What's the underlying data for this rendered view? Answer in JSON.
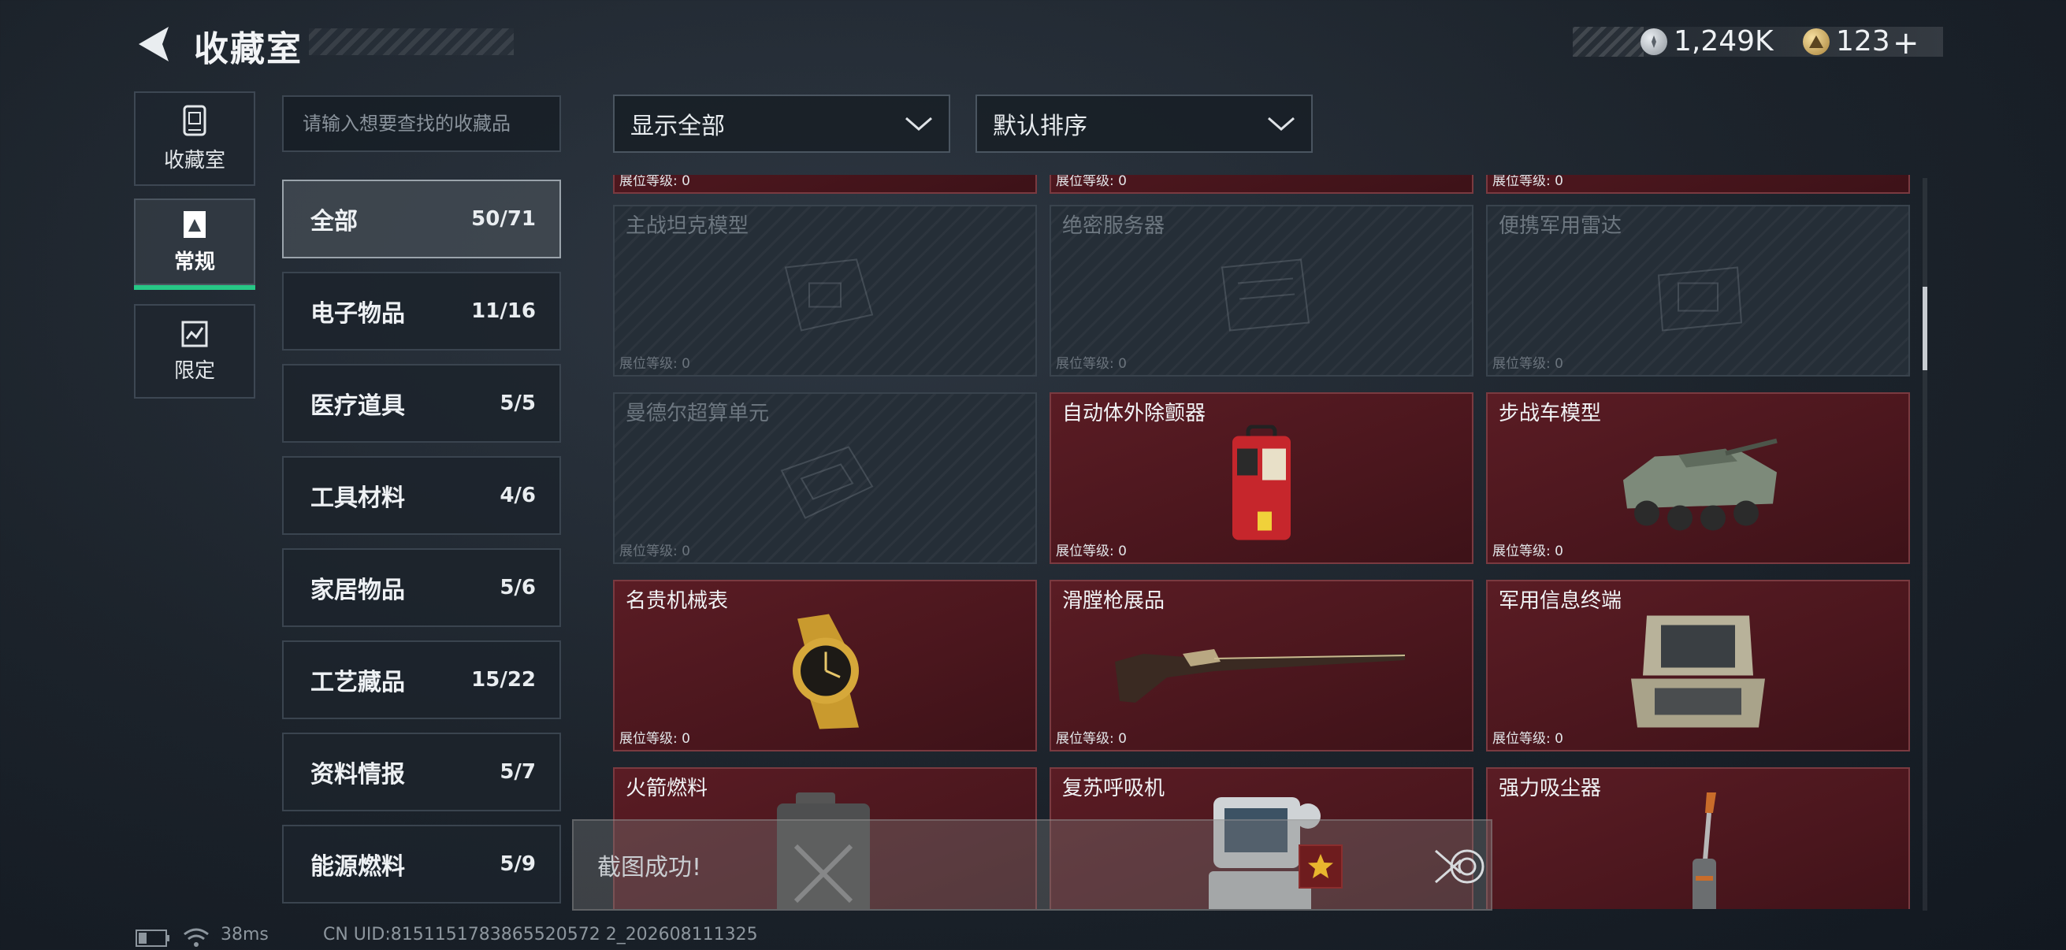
{
  "header": {
    "title": "收藏室"
  },
  "currency": {
    "silver": "1,249K",
    "gold": "123"
  },
  "rail": [
    {
      "label": "收藏室",
      "icon": "collection-icon"
    },
    {
      "label": "常规",
      "icon": "regular-icon",
      "active": true
    },
    {
      "label": "限定",
      "icon": "limited-icon"
    }
  ],
  "search": {
    "placeholder": "请输入想要查找的收藏品"
  },
  "filters": {
    "show": "显示全部",
    "sort": "默认排序"
  },
  "categories": [
    {
      "name": "全部",
      "count": "50/71",
      "active": true
    },
    {
      "name": "电子物品",
      "count": "11/16"
    },
    {
      "name": "医疗道具",
      "count": "5/5"
    },
    {
      "name": "工具材料",
      "count": "4/6"
    },
    {
      "name": "家居物品",
      "count": "5/6"
    },
    {
      "name": "工艺藏品",
      "count": "15/22"
    },
    {
      "name": "资料情报",
      "count": "5/7"
    },
    {
      "name": "能源燃料",
      "count": "5/9"
    }
  ],
  "cards": [
    {
      "name": "",
      "level": "展位等级: 0",
      "owned": true,
      "icon": ""
    },
    {
      "name": "",
      "level": "展位等级: 0",
      "owned": true,
      "icon": ""
    },
    {
      "name": "",
      "level": "展位等级: 0",
      "owned": true,
      "icon": ""
    },
    {
      "name": "主战坦克模型",
      "level": "展位等级: 0",
      "owned": false,
      "icon": "tank-model-icon"
    },
    {
      "name": "绝密服务器",
      "level": "展位等级: 0",
      "owned": false,
      "icon": "server-icon"
    },
    {
      "name": "便携军用雷达",
      "level": "展位等级: 0",
      "owned": false,
      "icon": "radar-icon"
    },
    {
      "name": "曼德尔超算单元",
      "level": "展位等级: 0",
      "owned": false,
      "icon": "supercomputer-icon"
    },
    {
      "name": "自动体外除颤器",
      "level": "展位等级: 0",
      "owned": true,
      "icon": "defibrillator-icon"
    },
    {
      "name": "步战车模型",
      "level": "展位等级: 0",
      "owned": true,
      "icon": "ifv-model-icon"
    },
    {
      "name": "名贵机械表",
      "level": "展位等级: 0",
      "owned": true,
      "icon": "watch-icon"
    },
    {
      "name": "滑膛枪展品",
      "level": "展位等级: 0",
      "owned": true,
      "icon": "musket-icon"
    },
    {
      "name": "军用信息终端",
      "level": "展位等级: 0",
      "owned": true,
      "icon": "terminal-icon"
    },
    {
      "name": "火箭燃料",
      "level": "",
      "owned": true,
      "icon": "fuel-can-icon"
    },
    {
      "name": "复苏呼吸机",
      "level": "",
      "owned": true,
      "icon": "ventilator-icon"
    },
    {
      "name": "强力吸尘器",
      "level": "",
      "owned": true,
      "icon": "vacuum-icon"
    }
  ],
  "toast": {
    "text": "截图成功!"
  },
  "status": {
    "ping": "38ms",
    "uid": "CN UID:8151151783865520572 2_202608111325"
  }
}
